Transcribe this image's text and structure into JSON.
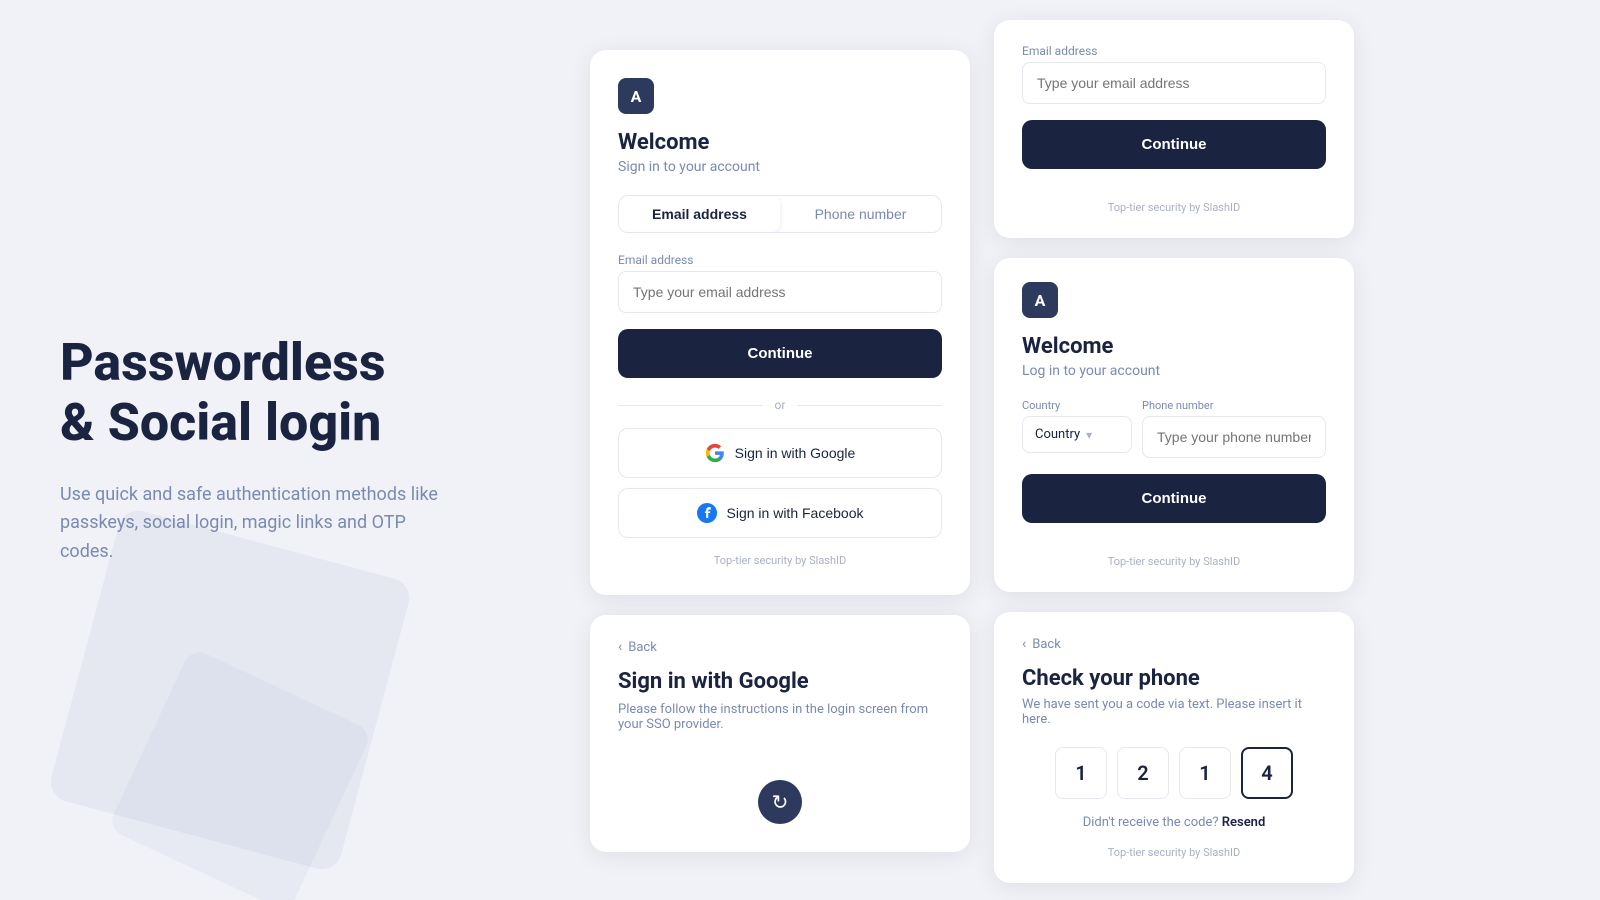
{
  "hero": {
    "title": "Passwordless\n& Social login",
    "subtitle": "Use quick and safe authentication methods like passkeys, social login, magic links and OTP codes."
  },
  "card_main": {
    "app_icon_label": "A",
    "title": "Welcome",
    "subtitle": "Sign in to your account",
    "tab_email": "Email address",
    "tab_phone": "Phone number",
    "email_label": "Email address",
    "email_placeholder": "Type your email address",
    "continue_label": "Continue",
    "divider_text": "or",
    "google_label": "Sign in with Google",
    "facebook_label": "Sign in with Facebook",
    "footer": "Top-tier security by SlashID"
  },
  "card_google_sso": {
    "back_label": "Back",
    "title": "Sign in with Google",
    "subtitle": "Please follow the instructions in the login screen from your SSO provider."
  },
  "side_card_email": {
    "email_label": "Email address",
    "email_placeholder": "Type your email address",
    "continue_label": "Continue",
    "footer": "Top-tier security by SlashID"
  },
  "side_card_phone": {
    "app_icon_label": "A",
    "title": "Welcome",
    "subtitle": "Log in to your account",
    "country_label": "Country",
    "country_placeholder": "Country",
    "phone_label": "Phone number",
    "phone_placeholder": "Type your phone number",
    "continue_label": "Continue",
    "footer": "Top-tier security by SlashID"
  },
  "side_card_otp": {
    "back_label": "Back",
    "title": "Check your phone",
    "subtitle": "We have sent you a code via text. Please insert it here.",
    "otp_digits": [
      "1",
      "2",
      "1",
      "4"
    ],
    "resend_text": "Didn't receive the code?",
    "resend_label": "Resend",
    "footer": "Top-tier security by SlashID"
  }
}
